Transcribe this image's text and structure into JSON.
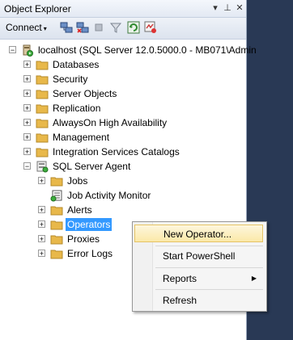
{
  "panel": {
    "title": "Object Explorer",
    "title_buttons": {
      "dropdown": "▾",
      "pin": "⊥",
      "close": "✕"
    },
    "toolbar": {
      "connect_label": "Connect",
      "connect_arrow": "▾"
    }
  },
  "tree": {
    "root": {
      "label": "localhost (SQL Server 12.0.5000.0 - MB071\\Admin"
    },
    "level1": [
      {
        "label": "Databases"
      },
      {
        "label": "Security"
      },
      {
        "label": "Server Objects"
      },
      {
        "label": "Replication"
      },
      {
        "label": "AlwaysOn High Availability"
      },
      {
        "label": "Management"
      },
      {
        "label": "Integration Services Catalogs"
      },
      {
        "label": "SQL Server Agent"
      }
    ],
    "agent_children": [
      {
        "label": "Jobs"
      },
      {
        "label": "Job Activity Monitor"
      },
      {
        "label": "Alerts"
      },
      {
        "label": "Operators"
      },
      {
        "label": "Proxies"
      },
      {
        "label": "Error Logs"
      }
    ],
    "expander_plus": "+",
    "expander_minus": "−"
  },
  "context_menu": {
    "items": [
      {
        "label": "New Operator..."
      },
      {
        "label": "Start PowerShell"
      },
      {
        "label": "Reports"
      },
      {
        "label": "Refresh"
      }
    ],
    "submenu_arrow": "▶"
  },
  "colors": {
    "selection": "#3399ff",
    "folder": "#e8b84a",
    "background_right": "#293955"
  }
}
